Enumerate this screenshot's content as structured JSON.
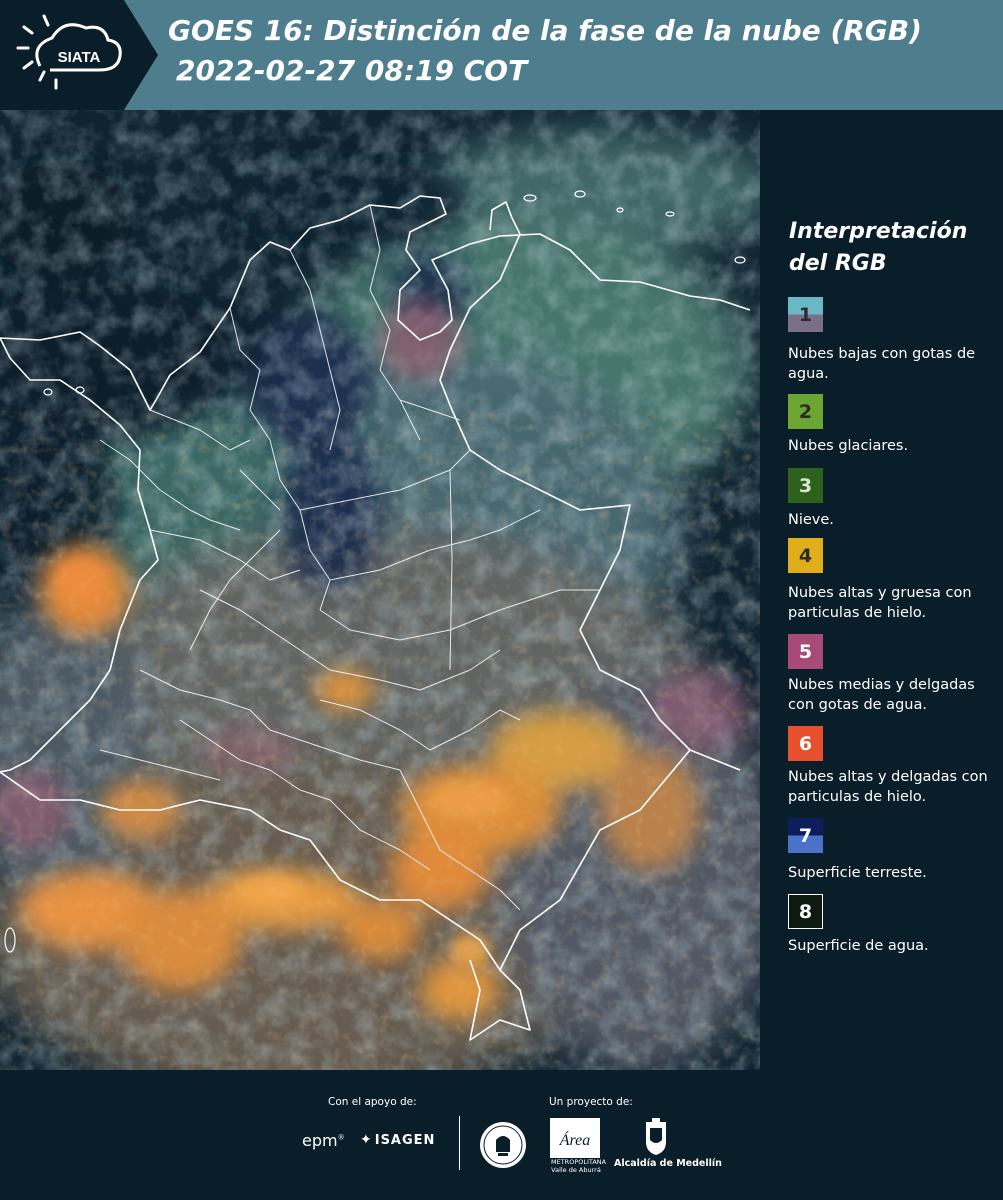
{
  "header": {
    "logo_text": "SIATA",
    "title_line1": "GOES 16: Distinción de la fase de la nube (RGB)",
    "title_line2": "2022-02-27 08:19 COT",
    "background_color": "#4e7d8e",
    "logo_panel_color": "#0a1e2a"
  },
  "map": {
    "image_type": "satellite-rgb-composite",
    "region": "Colombia",
    "boundary_color": "#ffffff"
  },
  "legend": {
    "title": "Interpretación del RGB",
    "items": [
      {
        "number": "1",
        "label": "Nubes bajas con gotas de agua.",
        "colors": [
          "#6ab8c6",
          "#7a6f85"
        ]
      },
      {
        "number": "2",
        "label": "Nubes glaciares.",
        "colors": [
          "#6aa631"
        ]
      },
      {
        "number": "3",
        "label": "Nieve.",
        "colors": [
          "#2d611c"
        ]
      },
      {
        "number": "4",
        "label": "Nubes altas y gruesa con particulas de hielo.",
        "colors": [
          "#e0ae1b"
        ]
      },
      {
        "number": "5",
        "label": "Nubes medias y delgadas con gotas de agua.",
        "colors": [
          "#a84a78"
        ]
      },
      {
        "number": "6",
        "label": "Nubes altas y delgadas con particulas de hielo.",
        "colors": [
          "#e6502c"
        ]
      },
      {
        "number": "7",
        "label": "Superficie terreste.",
        "colors": [
          "#0c1f5c",
          "#4a72c8"
        ]
      },
      {
        "number": "8",
        "label": "Superficie de agua.",
        "colors": [
          "#0c1a10"
        ]
      }
    ]
  },
  "footer": {
    "support_label": "Con el apoyo de:",
    "project_label": "Un proyecto de:",
    "sponsors": {
      "epm": "epm",
      "isagen": "ISAGEN",
      "area": "Área",
      "area_caption": "METROPOLITANA Valle de Aburrá",
      "alcaldia": "Alcaldía de Medellín"
    }
  }
}
